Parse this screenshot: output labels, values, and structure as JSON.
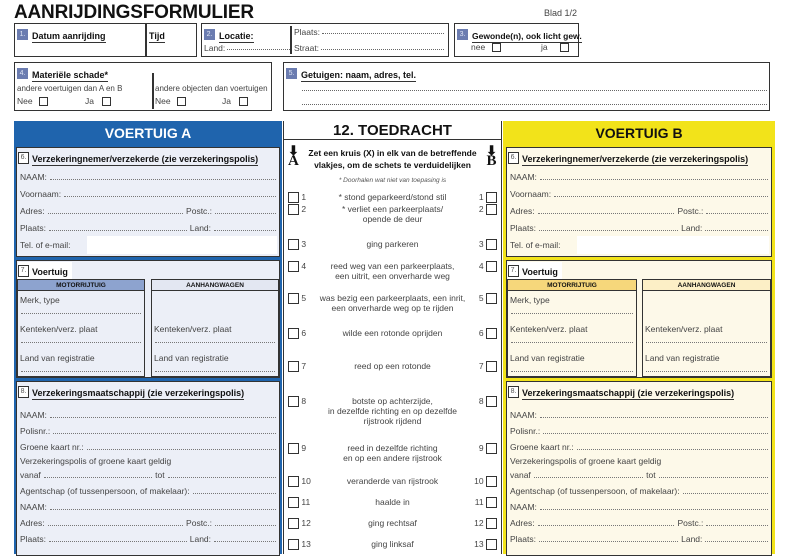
{
  "header": {
    "title": "AANRIJDINGSFORMULIER",
    "page": "Blad 1/2"
  },
  "sec1": {
    "num": "1.",
    "label": "Datum aanrijding",
    "time_label": "Tijd"
  },
  "sec2": {
    "num": "2.",
    "label": "Locatie:",
    "land": "Land:",
    "plaats": "Plaats:",
    "straat": "Straat:"
  },
  "sec3": {
    "num": "3.",
    "label": "Gewonde(n), ook licht gew.",
    "nee": "nee",
    "ja": "ja"
  },
  "sec4": {
    "num": "4.",
    "label": "Materiële schade*",
    "col1": "andere voertuigen dan A en B",
    "col2": "andere objecten dan voertuigen",
    "nee": "Nee",
    "ja": "Ja"
  },
  "sec5": {
    "num": "5.",
    "label": "Getuigen: naam, adres, tel."
  },
  "vehicleA": {
    "title": "VOERTUIG A",
    "color": "#1f64ad",
    "s6": {
      "num": "6.",
      "label": "Verzekeringnemer/verzekerde (zie verzekeringspolis)",
      "naam": "NAAM:",
      "voornaam": "Voornaam:",
      "adres": "Adres:",
      "postc": "Postc.:",
      "plaats": "Plaats:",
      "land": "Land:",
      "tel": "Tel. of e-mail:"
    },
    "s7": {
      "num": "7.",
      "label": "Voertuig",
      "motor": "MOTORRIJTUIG",
      "trailer": "AANHANGWAGEN",
      "merk": "Merk, type",
      "kenteken": "Kenteken/verz. plaat",
      "land": "Land van registratie"
    },
    "s8": {
      "num": "8.",
      "label": "Verzekeringsmaatschappij (zie verzekeringspolis)",
      "naam": "NAAM:",
      "polis": "Polisnr.:",
      "groene": "Groene kaart nr.:",
      "geldig": "Verzekeringspolis of groene kaart geldig",
      "vanaf": "vanaf",
      "tot": "tot",
      "agent": "Agentschap (of tussenpersoon, of makelaar):",
      "naam2": "NAAM:",
      "adres": "Adres:",
      "postc": "Postc.:",
      "plaats": "Plaats:",
      "land": "Land:"
    }
  },
  "vehicleB": {
    "title": "VOERTUIG B",
    "color": "#f2e31a",
    "s6": {
      "num": "6.",
      "label": "Verzekeringnemer/verzekerde (zie verzekeringspolis)",
      "naam": "NAAM:",
      "voornaam": "Voornaam:",
      "adres": "Adres:",
      "postc": "Postc.:",
      "plaats": "Plaats:",
      "land": "Land:",
      "tel": "Tel. of e-mail:"
    },
    "s7": {
      "num": "7.",
      "label": "Voertuig",
      "motor": "MOTORRIJTUIG",
      "trailer": "AANHANGWAGEN",
      "merk": "Merk, type",
      "kenteken": "Kenteken/verz. plaat",
      "land": "Land van registratie"
    },
    "s8": {
      "num": "8.",
      "label": "Verzekeringsmaatschappij (zie verzekeringspolis)",
      "naam": "NAAM:",
      "polis": "Polisnr.:",
      "groene": "Groene kaart nr.:",
      "geldig": "Verzekeringspolis of groene kaart geldig",
      "vanaf": "vanaf",
      "tot": "tot",
      "agent": "Agentschap (of tussenpersoon, of makelaar):",
      "naam2": "NAAM:",
      "adres": "Adres:",
      "postc": "Postc.:",
      "plaats": "Plaats:",
      "land": "Land:"
    }
  },
  "toedracht": {
    "title": "12. TOEDRACHT",
    "instruction1": "Zet een kruis (X) in elk van de betreffende",
    "instruction2": "vlakjes, om de schets te verduidelijken",
    "colA": "A",
    "colB": "B",
    "note": "* Doorhalen wat niet van toepasing is",
    "items": [
      {
        "n": "1",
        "text": "* stond geparkeerd/stond stil"
      },
      {
        "n": "2",
        "text": "* verliet een parkeerplaats/\nopende de deur"
      },
      {
        "n": "3",
        "text": "ging parkeren"
      },
      {
        "n": "4",
        "text": "reed weg van een parkeerplaats,\neen uitrit, een onverharde weg"
      },
      {
        "n": "5",
        "text": "was bezig een parkeerplaats, een inrit,\neen onverharde weg op te rijden"
      },
      {
        "n": "6",
        "text": "wilde een rotonde oprijden"
      },
      {
        "n": "7",
        "text": "reed op een rotonde"
      },
      {
        "n": "8",
        "text": "botste op achterzijde,\nin dezelfde richting en op dezelfde\nrijstrook rijdend"
      },
      {
        "n": "9",
        "text": "reed in dezelfde richting\nen op een andere rijstrook"
      },
      {
        "n": "10",
        "text": "veranderde van rijstrook"
      },
      {
        "n": "11",
        "text": "haalde in"
      },
      {
        "n": "12",
        "text": "ging rechtsaf"
      },
      {
        "n": "13",
        "text": "ging linksaf"
      }
    ]
  }
}
